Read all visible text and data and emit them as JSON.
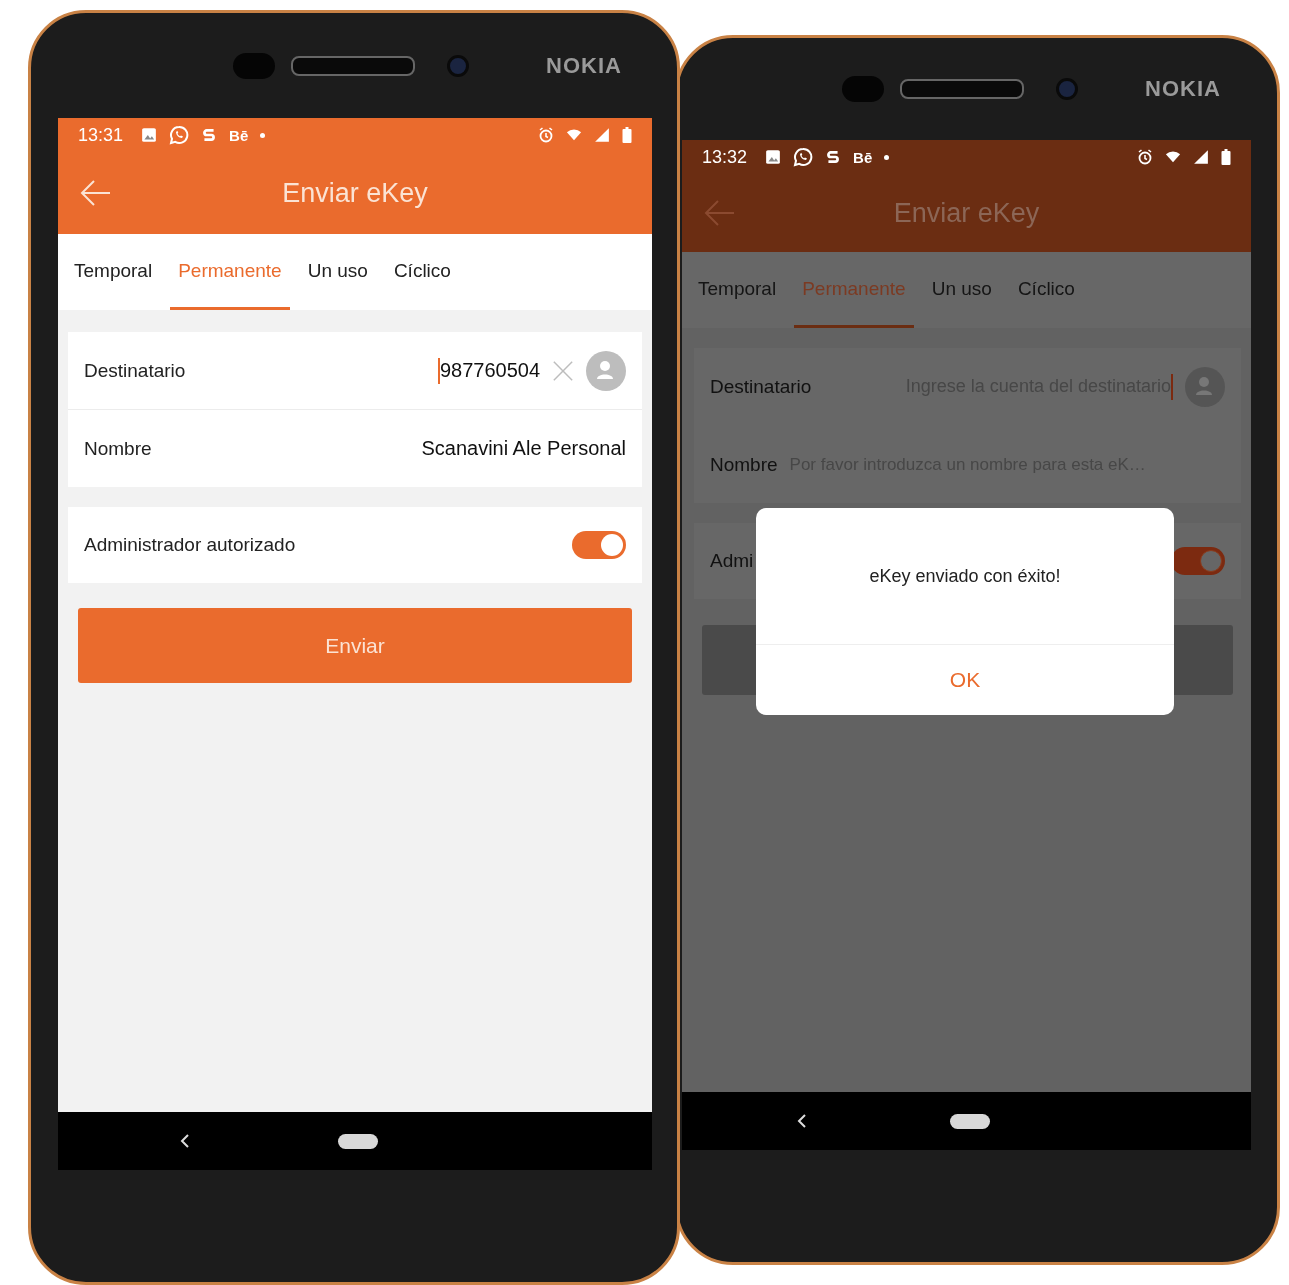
{
  "phones": [
    {
      "brand": "NOKIA",
      "dimmed": false,
      "status_bar": {
        "time": "13:31",
        "notification_text": "Bē"
      },
      "app_bar": {
        "title": "Enviar eKey"
      },
      "tabs": [
        {
          "label": "Temporal",
          "selected": false
        },
        {
          "label": "Permanente",
          "selected": true
        },
        {
          "label": "Un uso",
          "selected": false
        },
        {
          "label": "Cíclico",
          "selected": false
        }
      ],
      "fields": [
        {
          "label": "Destinatario",
          "value": "987760504",
          "focused": true,
          "clear_button": true,
          "contact_button": true
        },
        {
          "label": "Nombre",
          "value": "Scanavini Ale Personal",
          "focused": false
        }
      ],
      "admin_toggle": {
        "label": "Administrador autorizado",
        "on": true
      },
      "send_button": {
        "label": "Enviar"
      }
    },
    {
      "brand": "NOKIA",
      "dimmed": true,
      "status_bar": {
        "time": "13:32",
        "notification_text": "Bē"
      },
      "app_bar": {
        "title": "Enviar eKey"
      },
      "tabs": [
        {
          "label": "Temporal",
          "selected": false
        },
        {
          "label": "Permanente",
          "selected": true
        },
        {
          "label": "Un uso",
          "selected": false
        },
        {
          "label": "Cíclico",
          "selected": false
        }
      ],
      "fields": [
        {
          "label": "Destinatario",
          "placeholder": "Ingrese la cuenta del destinatario",
          "focused": true,
          "contact_button": true
        },
        {
          "label": "Nombre",
          "placeholder": "Por favor introduzca un nombre para esta eK…",
          "focused": false
        }
      ],
      "admin_toggle": {
        "label": "Admi",
        "on": true
      },
      "dialog": {
        "message": "eKey enviado con éxito!",
        "button": "OK"
      }
    }
  ]
}
